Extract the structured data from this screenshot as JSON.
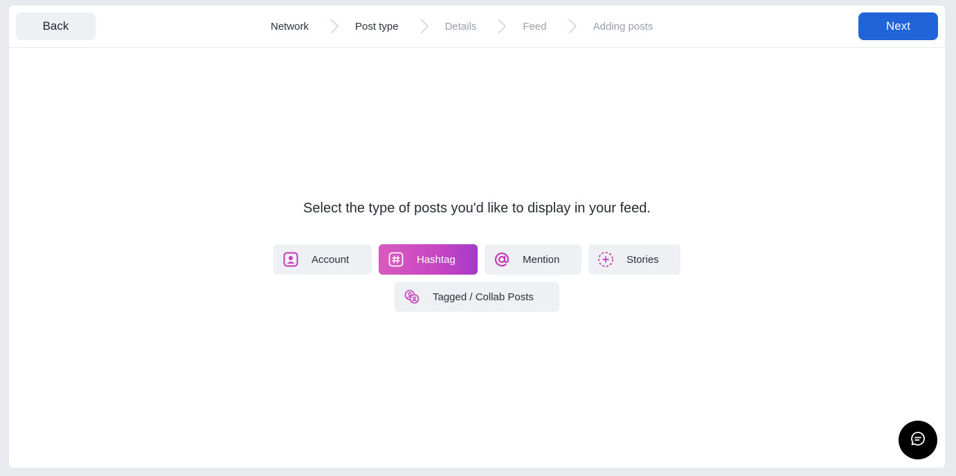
{
  "header": {
    "back_label": "Back",
    "next_label": "Next",
    "steps": [
      {
        "label": "Network",
        "state": "done"
      },
      {
        "label": "Post type",
        "state": "current"
      },
      {
        "label": "Details",
        "state": "upcoming"
      },
      {
        "label": "Feed",
        "state": "upcoming"
      },
      {
        "label": "Adding posts",
        "state": "upcoming"
      }
    ]
  },
  "main": {
    "prompt": "Select the type of posts you'd like to display in your feed.",
    "options": [
      {
        "label": "Account",
        "icon": "account-icon",
        "selected": false
      },
      {
        "label": "Hashtag",
        "icon": "hashtag-icon",
        "selected": true
      },
      {
        "label": "Mention",
        "icon": "at-icon",
        "selected": false
      },
      {
        "label": "Stories",
        "icon": "stories-icon",
        "selected": false
      },
      {
        "label": "Tagged / Collab Posts",
        "icon": "tagged-icon",
        "selected": false
      }
    ]
  },
  "chat": {
    "icon": "chat-icon"
  },
  "colors": {
    "accent": "#2164d9",
    "option_icon": "#c53ab8",
    "selected_gradient_start": "#d65bbf",
    "selected_gradient_end": "#a53ac9"
  }
}
